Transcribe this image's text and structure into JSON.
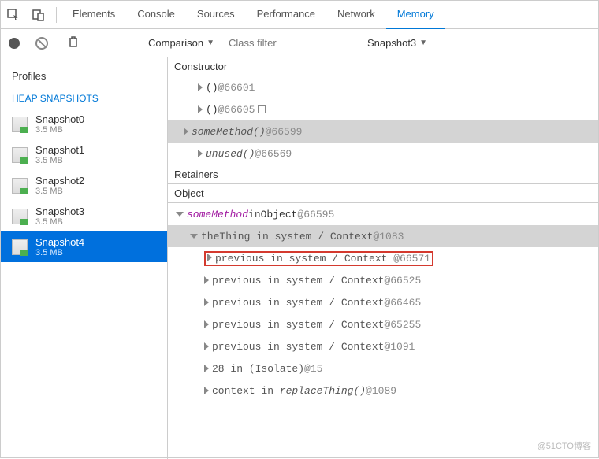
{
  "tabs": [
    "Elements",
    "Console",
    "Sources",
    "Performance",
    "Network",
    "Memory"
  ],
  "active_tab": "Memory",
  "toolbar": {
    "comparison": "Comparison",
    "class_filter_placeholder": "Class filter",
    "snapshot_selector": "Snapshot3"
  },
  "sidebar": {
    "title": "Profiles",
    "section": "HEAP SNAPSHOTS",
    "snapshots": [
      {
        "name": "Snapshot0",
        "size": "3.5 MB"
      },
      {
        "name": "Snapshot1",
        "size": "3.5 MB"
      },
      {
        "name": "Snapshot2",
        "size": "3.5 MB"
      },
      {
        "name": "Snapshot3",
        "size": "3.5 MB"
      },
      {
        "name": "Snapshot4",
        "size": "3.5 MB"
      }
    ],
    "active_index": 4
  },
  "constructor_header": "Constructor",
  "constructor_rows": [
    {
      "label": "()",
      "id": "@66601",
      "indent": 1,
      "arrow": "r"
    },
    {
      "label": "()",
      "id": "@66605",
      "indent": 1,
      "arrow": "r",
      "box": true
    },
    {
      "label": "someMethod()",
      "id": "@66599",
      "indent": 0,
      "arrow": "r",
      "selected": true,
      "italic": true
    },
    {
      "label": "unused()",
      "id": "@66569",
      "indent": 1,
      "arrow": "r",
      "italic": true
    }
  ],
  "retainers_header": "Retainers",
  "object_header": "Object",
  "retainer_rows": [
    {
      "arrow": "d",
      "indent": 0,
      "html": "<span class='pm'>someMethod</span> <span class='kw'>in</span> Object <span class='id'>@66595</span>"
    },
    {
      "arrow": "d",
      "indent": 1,
      "selected": true,
      "html": "<span class='kw'>theThing in system / Context</span> <span class='id'>@1083</span>"
    },
    {
      "arrow": "r",
      "indent": 2,
      "red": true,
      "html": "<span class='kw'>previous in system / Context</span> <span class='id'>@66571</span>"
    },
    {
      "arrow": "r",
      "indent": 2,
      "html": "<span class='kw'>previous in system / Context</span> <span class='id'>@66525</span>"
    },
    {
      "arrow": "r",
      "indent": 2,
      "html": "<span class='kw'>previous in system / Context</span> <span class='id'>@66465</span>"
    },
    {
      "arrow": "r",
      "indent": 2,
      "html": "<span class='kw'>previous in system / Context</span> <span class='id'>@65255</span>"
    },
    {
      "arrow": "r",
      "indent": 2,
      "html": "<span class='kw'>previous in system / Context</span> <span class='id'>@1091</span>"
    },
    {
      "arrow": "r",
      "indent": 2,
      "html": "<span class='kw'>28 in (Isolate)</span> <span class='id'>@15</span>"
    },
    {
      "arrow": "r",
      "indent": 2,
      "html": "<span class='kw'>context in <span class='fn'>replaceThing()</span></span> <span class='id'>@1089</span>"
    }
  ],
  "watermark": "@51CTO博客"
}
